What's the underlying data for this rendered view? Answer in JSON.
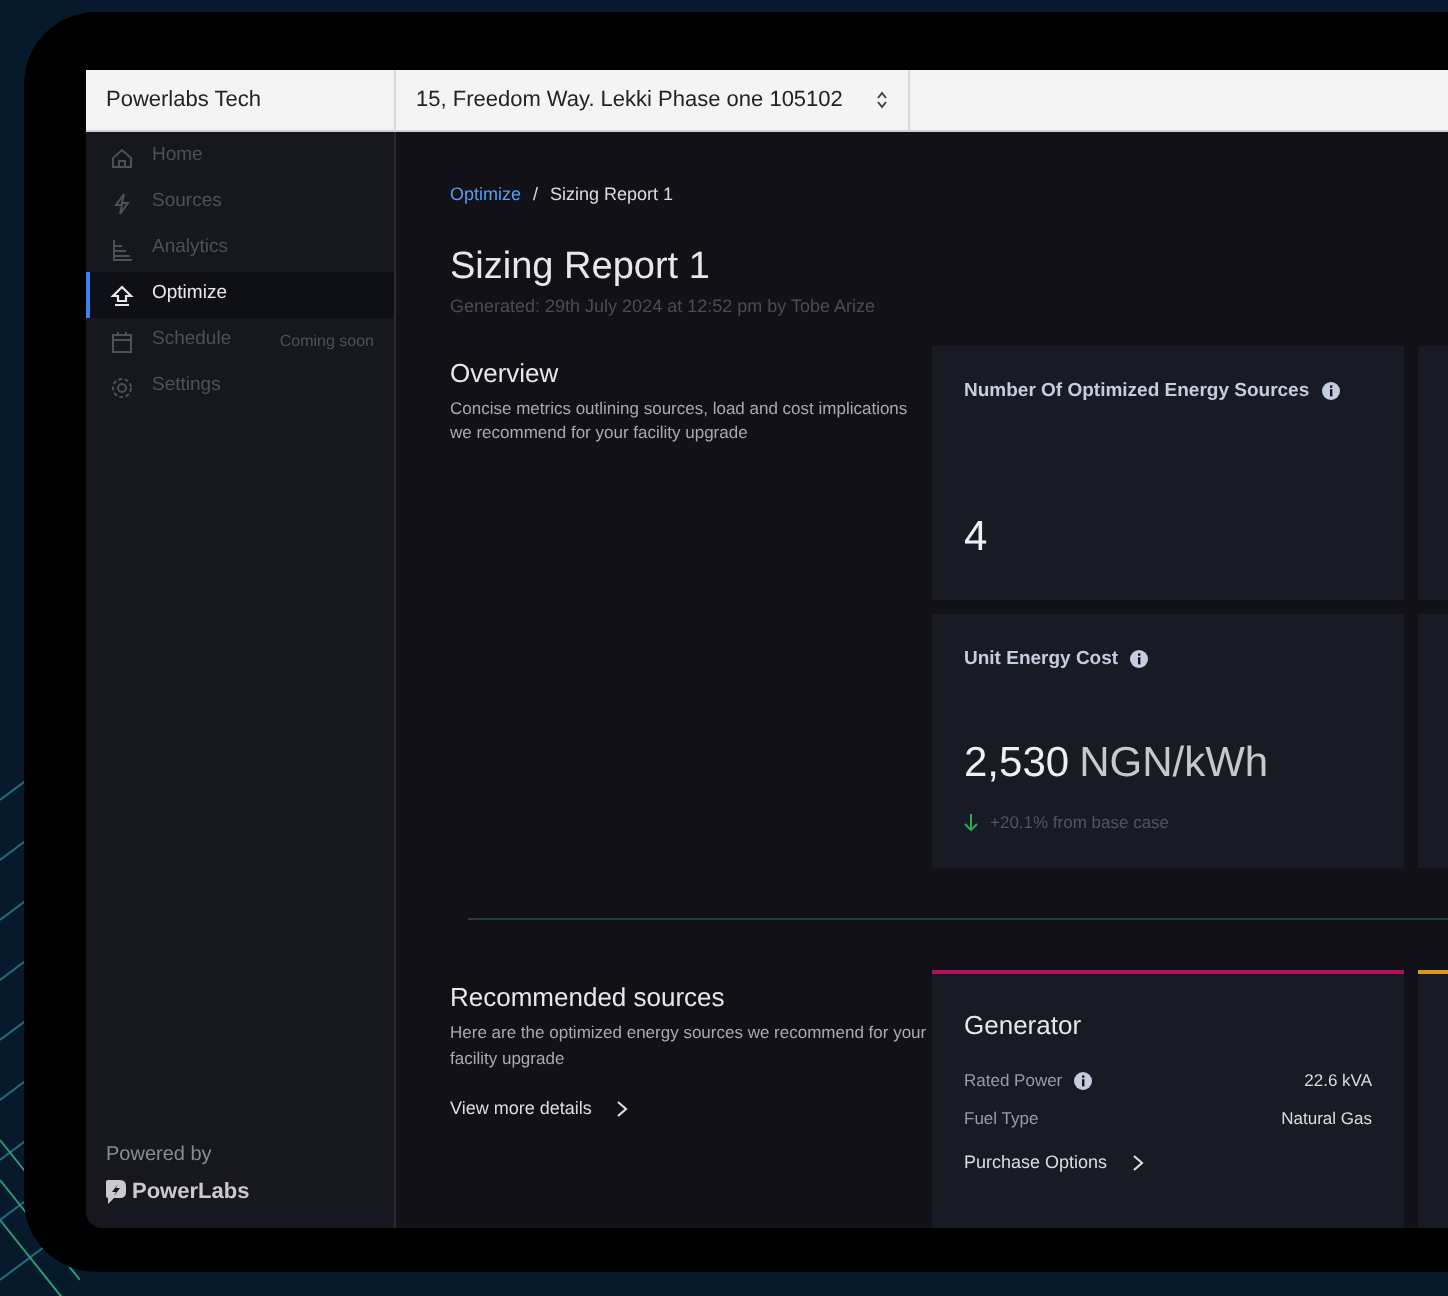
{
  "topbar": {
    "company": "Powerlabs Tech",
    "location": {
      "value": "15, Freedom Way. Lekki Phase one 105102"
    }
  },
  "sidebar": {
    "items": [
      {
        "label": "Home",
        "selected": false
      },
      {
        "label": "Sources",
        "selected": false
      },
      {
        "label": "Analytics",
        "selected": false
      },
      {
        "label": "Optimize",
        "selected": true
      },
      {
        "label": "Schedule",
        "selected": false,
        "badge": "Coming soon"
      },
      {
        "label": "Settings",
        "selected": false
      }
    ],
    "powered_by": "Powered by",
    "brand": "PowerLabs"
  },
  "breadcrumb": {
    "items": [
      {
        "label": "Optimize",
        "kind": "link"
      },
      {
        "label": "Sizing Report 1",
        "kind": "current"
      }
    ],
    "separator": "/"
  },
  "title": "Sizing Report 1",
  "subtitle": "Generated: 29th July 2024 at 12:52 pm by Tobe Arize",
  "overview": {
    "heading": "Overview",
    "description": "Concise metrics outlining sources, load and cost implications we recommend for your facility upgrade",
    "metrics": [
      {
        "label": "Number Of Optimized Energy Sources",
        "value": "4"
      },
      {
        "label": "Unit Energy Cost",
        "value": "2,530",
        "unit": "NGN/kWh",
        "change": {
          "text": "+20.1% from base case",
          "down": true
        }
      }
    ]
  },
  "recommended": {
    "heading": "Recommended sources",
    "description": "Here are the optimized energy sources we recommend for your facility upgrade",
    "link": "View more details",
    "sources": [
      {
        "name": "Generator",
        "color": "#b0125f",
        "rows": [
          {
            "label": "Rated Power",
            "value": "22.6 kVA",
            "info": true
          },
          {
            "label": "Fuel Type",
            "value": "Natural Gas",
            "info": false
          }
        ],
        "link": "Purchase Options"
      },
      {
        "color": "#d99a1e"
      }
    ]
  }
}
